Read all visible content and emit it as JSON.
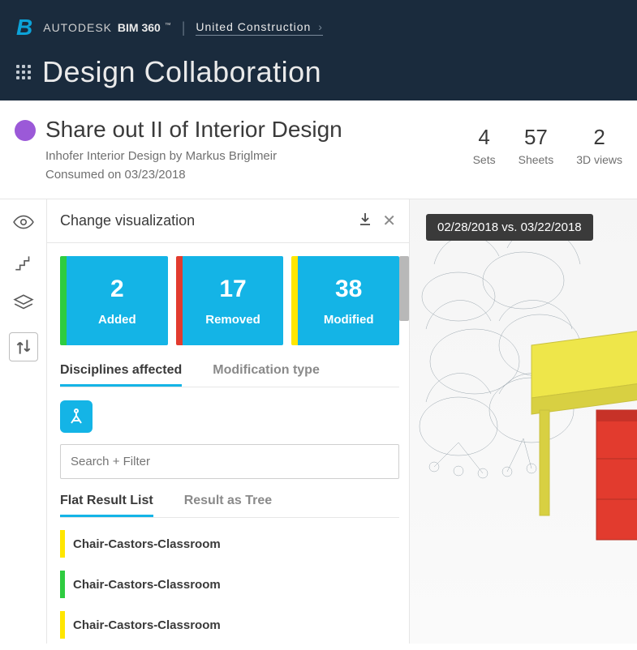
{
  "header": {
    "brand_light": "AUTODESK",
    "brand_bold": "BIM 360",
    "company": "United Construction",
    "title": "Design Collaboration"
  },
  "subheader": {
    "title": "Share out II of Interior Design",
    "meta_line1": "Inhofer Interior Design by Markus Briglmeir",
    "meta_line2": "Consumed on 03/23/2018",
    "stats": [
      {
        "value": "4",
        "label": "Sets"
      },
      {
        "value": "57",
        "label": "Sheets"
      },
      {
        "value": "2",
        "label": "3D views"
      }
    ]
  },
  "panel": {
    "title": "Change visualization",
    "cards": [
      {
        "num": "2",
        "label": "Added",
        "cls": "added"
      },
      {
        "num": "17",
        "label": "Removed",
        "cls": "removed"
      },
      {
        "num": "38",
        "label": "Modified",
        "cls": "modified"
      }
    ],
    "tabs": {
      "disciplines": "Disciplines affected",
      "modtype": "Modification type"
    },
    "search_placeholder": "Search + Filter",
    "subtabs": {
      "flat": "Flat Result List",
      "tree": "Result as Tree"
    },
    "results": [
      {
        "color": "yellow",
        "text": "Chair-Castors-Classroom"
      },
      {
        "color": "green",
        "text": "Chair-Castors-Classroom"
      },
      {
        "color": "yellow",
        "text": "Chair-Castors-Classroom"
      }
    ]
  },
  "viewer": {
    "compare_label": "02/28/2018 vs. 03/22/2018"
  }
}
